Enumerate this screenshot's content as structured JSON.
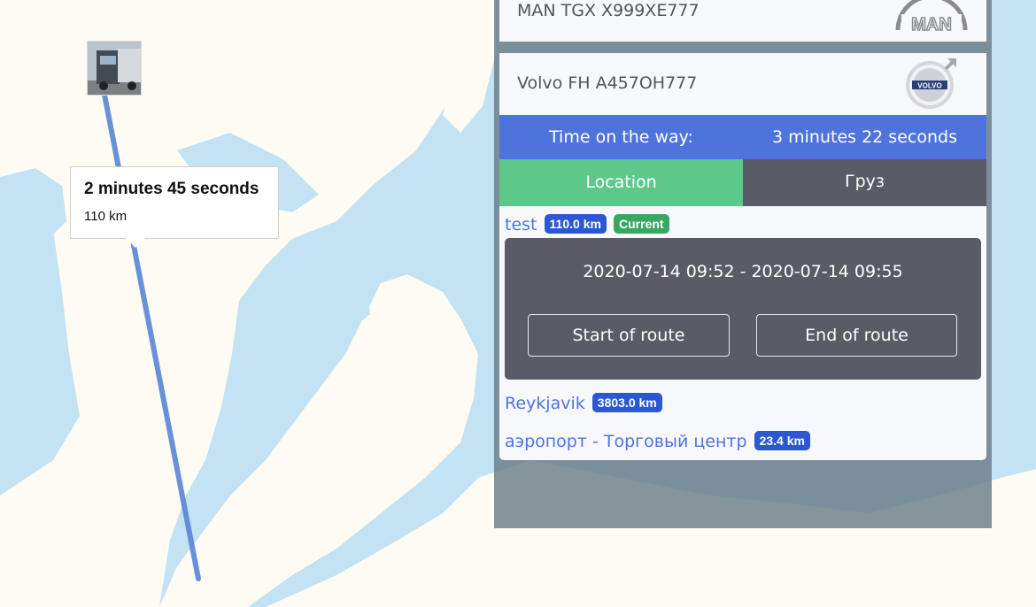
{
  "map": {
    "popup": {
      "title": "2 minutes 45 seconds",
      "distance": "110 km"
    },
    "colors": {
      "land": "#fdfbf2",
      "water": "#c3e2f3",
      "route": "#5a86d8"
    }
  },
  "vehicles": [
    {
      "name": "MAN TGX X999XE777",
      "logo": "man-logo"
    },
    {
      "name": "Volvo FH A457OH777",
      "logo": "volvo-logo"
    }
  ],
  "trip": {
    "time_label": "Time on the way:",
    "time_value": "3 minutes 22 seconds"
  },
  "tabs": {
    "location": "Location",
    "cargo": "Груз"
  },
  "routes": [
    {
      "name": "test",
      "distance": "110.0 km",
      "status": "Current"
    },
    {
      "name": "Reykjavik",
      "distance": "3803.0 km"
    },
    {
      "name": "аэропорт - Торговый центр",
      "distance": "23.4 km"
    }
  ],
  "current_route": {
    "period": "2020-07-14 09:52 - 2020-07-14 09:55",
    "start_button": "Start of route",
    "end_button": "End of route"
  },
  "colors": {
    "accent_blue": "#4f73dd",
    "tab_active": "#5ec88a",
    "tab_inactive": "#5a5b66",
    "badge_blue": "#2b58d0",
    "badge_green": "#3aa760"
  }
}
